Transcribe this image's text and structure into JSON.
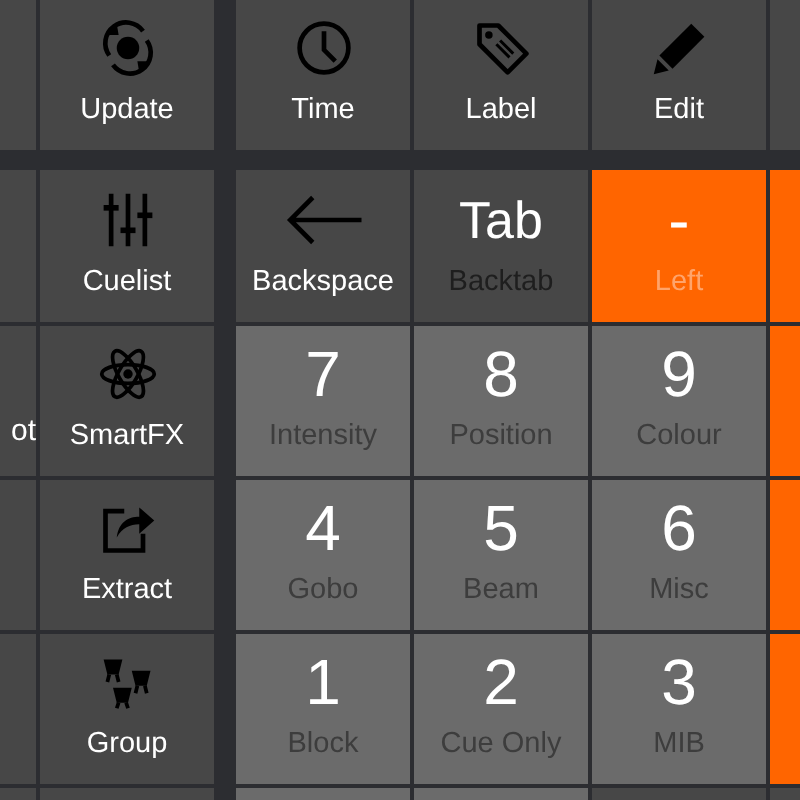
{
  "rows": [
    {
      "cells": [
        {
          "kind": "blank",
          "color": "#474747"
        },
        {
          "kind": "tool",
          "color": "#474747",
          "label": "Update"
        },
        {
          "kind": "tool",
          "color": "#474747",
          "label": "Time"
        },
        {
          "kind": "tool",
          "color": "#474747",
          "label": "Label"
        },
        {
          "kind": "tool",
          "color": "#474747",
          "label": "Edit"
        },
        {
          "kind": "blank",
          "color": "#474747"
        }
      ]
    },
    {
      "cells": [
        {
          "kind": "blank",
          "color": "#474747"
        },
        {
          "kind": "tool",
          "color": "#474747",
          "label": "Cuelist"
        },
        {
          "kind": "tool",
          "color": "#474747",
          "label": "Backspace"
        },
        {
          "kind": "key",
          "color": "#474747",
          "main": "Tab",
          "sub": "Backtab"
        },
        {
          "kind": "key",
          "color": "#ff6500",
          "main": "-",
          "sub": "Left"
        },
        {
          "kind": "blank",
          "color": "#ff6500"
        }
      ]
    },
    {
      "cells": [
        {
          "kind": "partial",
          "color": "#474747",
          "label": "ot"
        },
        {
          "kind": "tool",
          "color": "#474747",
          "label": "SmartFX"
        },
        {
          "kind": "key",
          "color": "#6b6b6b",
          "main": "7",
          "sub": "Intensity"
        },
        {
          "kind": "key",
          "color": "#6b6b6b",
          "main": "8",
          "sub": "Position"
        },
        {
          "kind": "key",
          "color": "#6b6b6b",
          "main": "9",
          "sub": "Colour"
        },
        {
          "kind": "blank",
          "color": "#ff6500"
        }
      ]
    },
    {
      "cells": [
        {
          "kind": "blank",
          "color": "#474747"
        },
        {
          "kind": "tool",
          "color": "#474747",
          "label": "Extract"
        },
        {
          "kind": "key",
          "color": "#6b6b6b",
          "main": "4",
          "sub": "Gobo"
        },
        {
          "kind": "key",
          "color": "#6b6b6b",
          "main": "5",
          "sub": "Beam"
        },
        {
          "kind": "key",
          "color": "#6b6b6b",
          "main": "6",
          "sub": "Misc"
        },
        {
          "kind": "blank",
          "color": "#ff6500"
        }
      ]
    },
    {
      "cells": [
        {
          "kind": "blank",
          "color": "#474747"
        },
        {
          "kind": "tool",
          "color": "#474747",
          "label": "Group"
        },
        {
          "kind": "key",
          "color": "#6b6b6b",
          "main": "1",
          "sub": "Block"
        },
        {
          "kind": "key",
          "color": "#6b6b6b",
          "main": "2",
          "sub": "Cue Only"
        },
        {
          "kind": "key",
          "color": "#6b6b6b",
          "main": "3",
          "sub": "MIB"
        },
        {
          "kind": "blank",
          "color": "#ff6500"
        }
      ]
    },
    {
      "cells": [
        {
          "kind": "blank",
          "color": "#474747"
        },
        {
          "kind": "blank",
          "color": "#474747"
        },
        {
          "kind": "blank",
          "color": "#6b6b6b"
        },
        {
          "kind": "blank",
          "color": "#6b6b6b"
        },
        {
          "kind": "blank",
          "color": "#474747"
        },
        {
          "kind": "blank",
          "color": "#474747"
        }
      ]
    }
  ]
}
